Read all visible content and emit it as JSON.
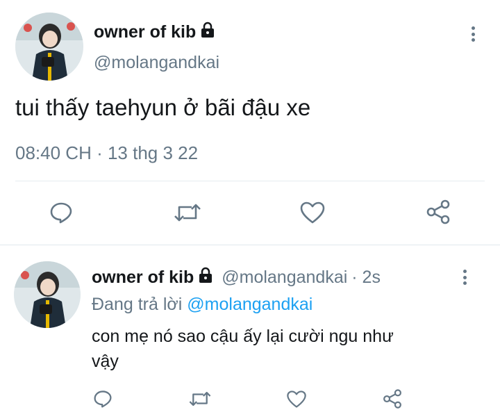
{
  "main_tweet": {
    "display_name": "owner of kib",
    "handle": "@molangandkai",
    "text": "tui thấy taehyun ở bãi đậu xe",
    "timestamp": "08:40 CH · 13 thg 3 22",
    "lock_icon": "lock-icon",
    "actions": [
      "reply-icon",
      "retweet-icon",
      "like-icon",
      "share-icon"
    ]
  },
  "reply_tweet": {
    "display_name": "owner of kib",
    "handle": "@molangandkai",
    "time_ago": "· 2s",
    "replying_prefix": "Đang trả lời ",
    "replying_to": "@molangandkai",
    "text_line1": "con mẹ nó sao cậu ấy lại cười ngu như",
    "text_line2": "vậy",
    "actions": [
      "reply-icon",
      "retweet-icon",
      "like-icon",
      "share-icon"
    ]
  },
  "colors": {
    "text": "#14171a",
    "secondary": "#657786",
    "link": "#1da1f2",
    "divider": "#e6ecf0"
  }
}
